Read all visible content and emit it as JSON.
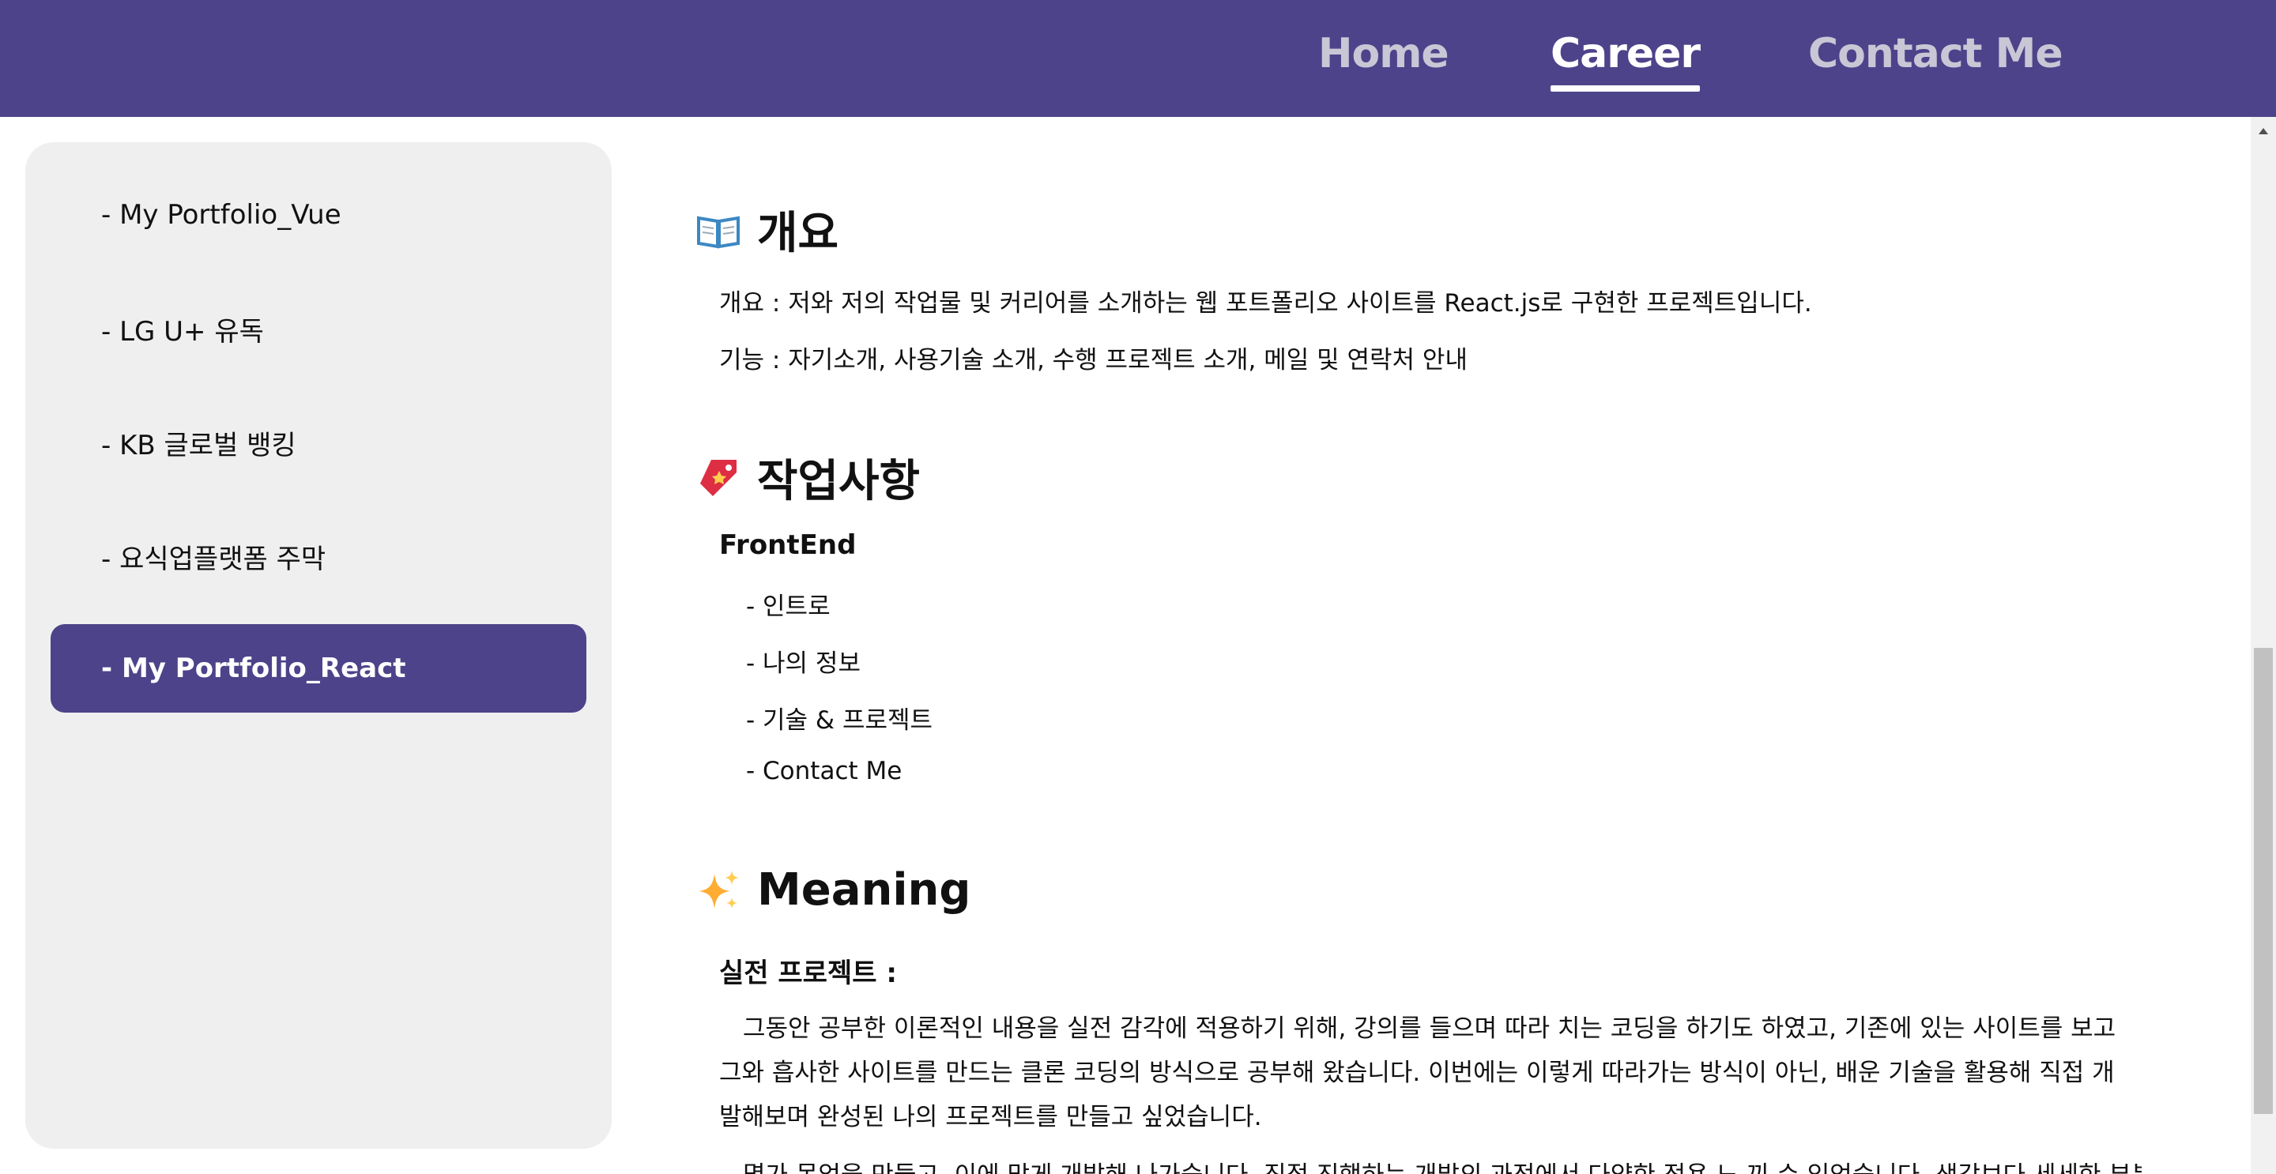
{
  "nav": {
    "home": "Home",
    "career": "Career",
    "contact": "Contact Me"
  },
  "sidebar": {
    "items": [
      {
        "label": "- My Portfolio_Vue"
      },
      {
        "label": "- LG U+ 유독"
      },
      {
        "label": "- KB 글로벌 뱅킹"
      },
      {
        "label": "- 요식업플랫폼 주막"
      },
      {
        "label": "- My Portfolio_React",
        "active": true
      }
    ]
  },
  "content": {
    "overview": {
      "icon": "open-book-icon",
      "title": "개요",
      "summary": "개요 : 저와 저의 작업물 및 커리어를 소개하는 웹 포트폴리오 사이트를 React.js로 구현한 프로젝트입니다.",
      "features": "기능 : 자기소개, 사용기술 소개, 수행 프로젝트 소개, 메일 및 연락처 안내"
    },
    "work": {
      "icon": "bookmark-tag-icon",
      "title": "작업사항",
      "subtitle": "FrontEnd",
      "items": [
        "- 인트로",
        "- 나의 정보",
        "- 기술 & 프로젝트",
        "- Contact Me"
      ]
    },
    "meaning": {
      "icon": "sparkles-icon",
      "title": "Meaning",
      "subtitle": "실전 프로젝트 :",
      "paragraph": "그동안 공부한 이론적인 내용을 실전 감각에 적용하기 위해, 강의를 들으며 따라 치는 코딩을 하기도 하였고, 기존에 있는 사이트를 보고 그와 흡사한 사이트를 만드는 클론 코딩의 방식으로 공부해 왔습니다. 이번에는 이렇게 따라가는 방식이 아닌, 배운 기술을 활용해 직접 개발해보며 완성된 나의 프로젝트를 만들고 싶었습니다.",
      "next_line": "몇가 목업을 만들고, 이에 맞게 개발해 나가습니다. 직접 진행하는 개발의 과정에서 다양한 적용 느 끼 수 있었습니다. 생각보다 세세한 부분"
    }
  },
  "colors": {
    "accent": "#4d438a",
    "sidebar_bg": "#efefef"
  }
}
